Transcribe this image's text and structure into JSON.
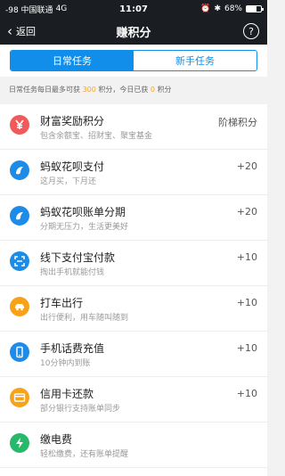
{
  "status_bar": {
    "carrier": "-98 中国联通",
    "network": "4G",
    "time": "11:07",
    "battery": "68%",
    "battery_level": 0.68
  },
  "nav": {
    "back_label": "返回",
    "title": "赚积分",
    "help": "?"
  },
  "tabs": [
    {
      "label": "日常任务",
      "active": true
    },
    {
      "label": "新手任务",
      "active": false
    }
  ],
  "info": {
    "prefix": "日常任务每日最多可获",
    "max": "300",
    "mid": "积分，今日已获",
    "earned": "0",
    "suffix": "积分"
  },
  "tasks": [
    {
      "title": "财富奖励积分",
      "subtitle": "包含余额宝、招财宝、聚宝基金",
      "points": "阶梯积分",
      "icon": "yen-icon",
      "color": "#f05a5a"
    },
    {
      "title": "蚂蚁花呗支付",
      "subtitle": "这月买，下月还",
      "points": "+20",
      "icon": "huabei-icon",
      "color": "#1d8be8"
    },
    {
      "title": "蚂蚁花呗账单分期",
      "subtitle": "分期无压力，生活更美好",
      "points": "+20",
      "icon": "huabei-icon",
      "color": "#1d8be8"
    },
    {
      "title": "线下支付宝付款",
      "subtitle": "掏出手机就能付钱",
      "points": "+10",
      "icon": "scan-icon",
      "color": "#1d8be8"
    },
    {
      "title": "打车出行",
      "subtitle": "出行便利，用车随叫随到",
      "points": "+10",
      "icon": "car-icon",
      "color": "#f7a21b"
    },
    {
      "title": "手机话费充值",
      "subtitle": "10分钟内到账",
      "points": "+10",
      "icon": "phone-icon",
      "color": "#1d8be8"
    },
    {
      "title": "信用卡还款",
      "subtitle": "部分银行支持账单同步",
      "points": "+10",
      "icon": "credit-card-icon",
      "color": "#f7a21b"
    },
    {
      "title": "缴电费",
      "subtitle": "轻松缴费，还有账单提醒",
      "points": "",
      "icon": "lightning-icon",
      "color": "#27b86b"
    }
  ]
}
